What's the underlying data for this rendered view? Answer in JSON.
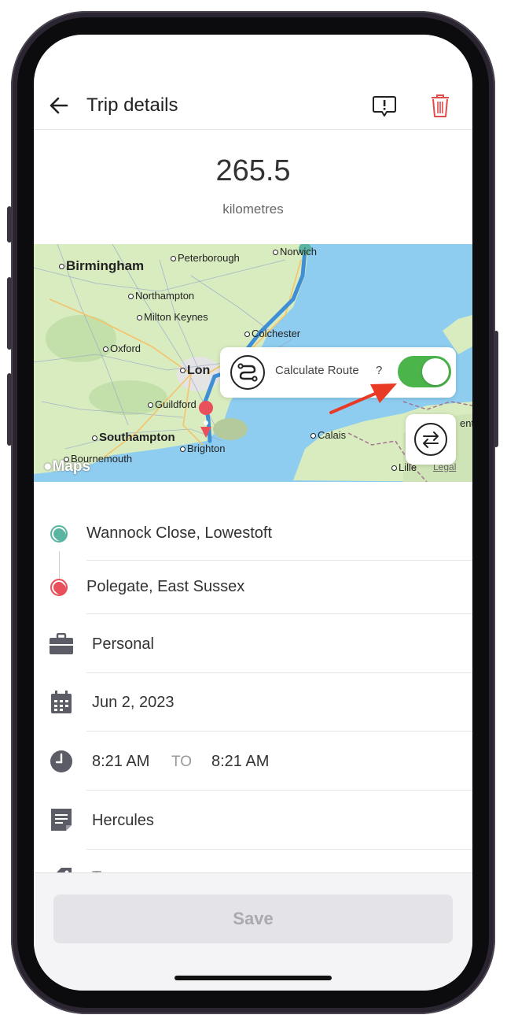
{
  "header": {
    "title": "Trip details"
  },
  "trip": {
    "distance": "265.5",
    "unit": "kilometres"
  },
  "map": {
    "cities": [
      "Birmingham",
      "Peterborough",
      "Norwich",
      "Northampton",
      "Milton Keynes",
      "Colchester",
      "Oxford",
      "Lon",
      "Guildford",
      "Southampton",
      "Brighton",
      "Bournemouth",
      "Calais",
      "Lille"
    ],
    "partial_labels": [
      "ent"
    ],
    "logo": "Maps",
    "legal": "Legal",
    "colors": {
      "sea": "#8ecdf0",
      "land": "#d8ecc0",
      "route": "#3f8fd6",
      "start": "#5bb5a2",
      "end": "#e8505b"
    }
  },
  "calculate_route": {
    "label": "Calculate Route",
    "help": "?",
    "enabled": true
  },
  "locations": {
    "start": "Wannock Close, Lowestoft",
    "end": "Polegate, East Sussex"
  },
  "details": {
    "category": "Personal",
    "date": "Jun 2, 2023",
    "start_time": "8:21 AM",
    "to_label": "TO",
    "end_time": "8:21 AM",
    "vehicle": "Hercules",
    "tags_partial": "T"
  },
  "footer": {
    "save_label": "Save"
  },
  "icons": [
    "back-arrow-icon",
    "report-icon",
    "trash-icon",
    "route-icon",
    "swap-icon",
    "briefcase-icon",
    "calendar-icon",
    "clock-icon",
    "note-icon",
    "tag-icon"
  ]
}
